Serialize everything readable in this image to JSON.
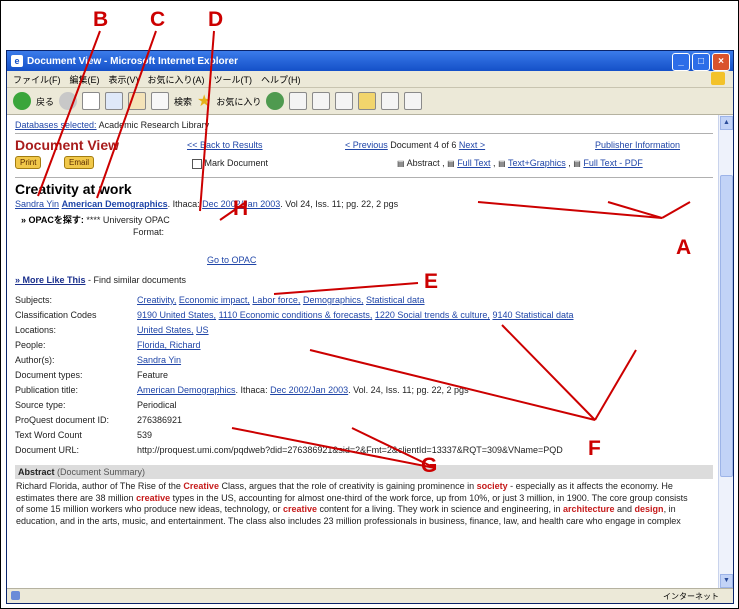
{
  "callouts": {
    "A": "A",
    "B": "B",
    "C": "C",
    "D": "D",
    "E": "E",
    "F": "F",
    "G": "G",
    "H": "H"
  },
  "window": {
    "title": "Document View - Microsoft Internet Explorer",
    "menu": [
      "ファイル(F)",
      "編集(E)",
      "表示(V)",
      "お気に入り(A)",
      "ツール(T)",
      "ヘルプ(H)"
    ],
    "toolbar": {
      "back": "戻る",
      "search": "検索",
      "favorites": "お気に入り"
    },
    "status_zone": "インターネット"
  },
  "header": {
    "databases_label": "Databases selected:",
    "database": "Academic Research Library",
    "doc_view": "Document View",
    "back_to_results": "<< Back to Results",
    "previous": "< Previous",
    "doc_position": "Document 4 of 6",
    "next": "Next >",
    "publisher_info": "Publisher Information",
    "print": "Print",
    "email": "Email",
    "mark_document": "Mark Document",
    "abstract": "Abstract ,",
    "full_text": "Full Text",
    "text_graphics": "Text+Graphics",
    "full_text_pdf": "Full Text - PDF"
  },
  "article": {
    "title": "Creativity at work",
    "author": "Sandra Yin",
    "publication": "American Demographics",
    "place": ". Ithaca:",
    "date": "Dec 2002/Jan 2003",
    "vol": ". Vol 24, Iss. 11;  pg. 22, 2 pgs",
    "opac_label": "» OPACを探す:",
    "opac_stars": "****",
    "opac_univ": "University OPAC",
    "opac_format": "Format:",
    "go_to_opac": "Go to OPAC",
    "more_like_this": "» More Like This",
    "find_similar": " - Find similar documents"
  },
  "fields": {
    "subjects_label": "Subjects:",
    "subjects": [
      "Creativity,",
      "Economic impact,",
      "Labor force,",
      "Demographics,",
      "Statistical data"
    ],
    "class_label": "Classification Codes",
    "class_codes": [
      "9190 United States,",
      "1110 Economic conditions & forecasts,",
      "1220 Social trends & culture,",
      "9140 Statistical data"
    ],
    "locations_label": "Locations:",
    "locations": [
      "United States,",
      "US"
    ],
    "people_label": "People:",
    "people": "Florida, Richard",
    "authors_label": "Author(s):",
    "authors": "Sandra Yin",
    "doctype_label": "Document types:",
    "doctype": "Feature",
    "pubtitle_label": "Publication title:",
    "pubtitle": "American Demographics",
    "pub_place": ". Ithaca:",
    "pub_date": "Dec 2002/Jan 2003",
    "pub_vol": ". Vol. 24, Iss. 11;  pg. 22, 2 pgs",
    "source_label": "Source type:",
    "source": "Periodical",
    "pqid_label": "ProQuest document ID:",
    "pqid": "276386921",
    "wordcount_label": "Text Word Count",
    "wordcount": "539",
    "url_label": "Document URL:",
    "url": "http://proquest.umi.com/pqdweb?did=276386921&sid=2&Fmt=2&clientId=13337&RQT=309&VName=PQD"
  },
  "abstract": {
    "heading": "Abstract",
    "sub": " (Document Summary)",
    "t1": "Richard Florida, author of The Rise of the ",
    "k1": "Creative",
    "t2": " Class, argues that the role of creativity is gaining prominence in ",
    "k2": "society",
    "t3": " - especially as it affects the economy. He estimates there are 38 million ",
    "k3": "creative",
    "t4": " types in the US, accounting for almost one-third of the work force, up from 10%, or just 3 million, in 1900. The core group consists of some 15 million workers who produce new ideas, technology, or ",
    "k4": "creative",
    "t5": " content for a living. They work in science and engineering, in ",
    "k5": "architecture",
    "t6": " and ",
    "k6": "design",
    "t7": ", in education, and in the arts, music, and entertainment. The class also includes 23 million professionals in business, finance, law, and health care who engage in complex"
  }
}
